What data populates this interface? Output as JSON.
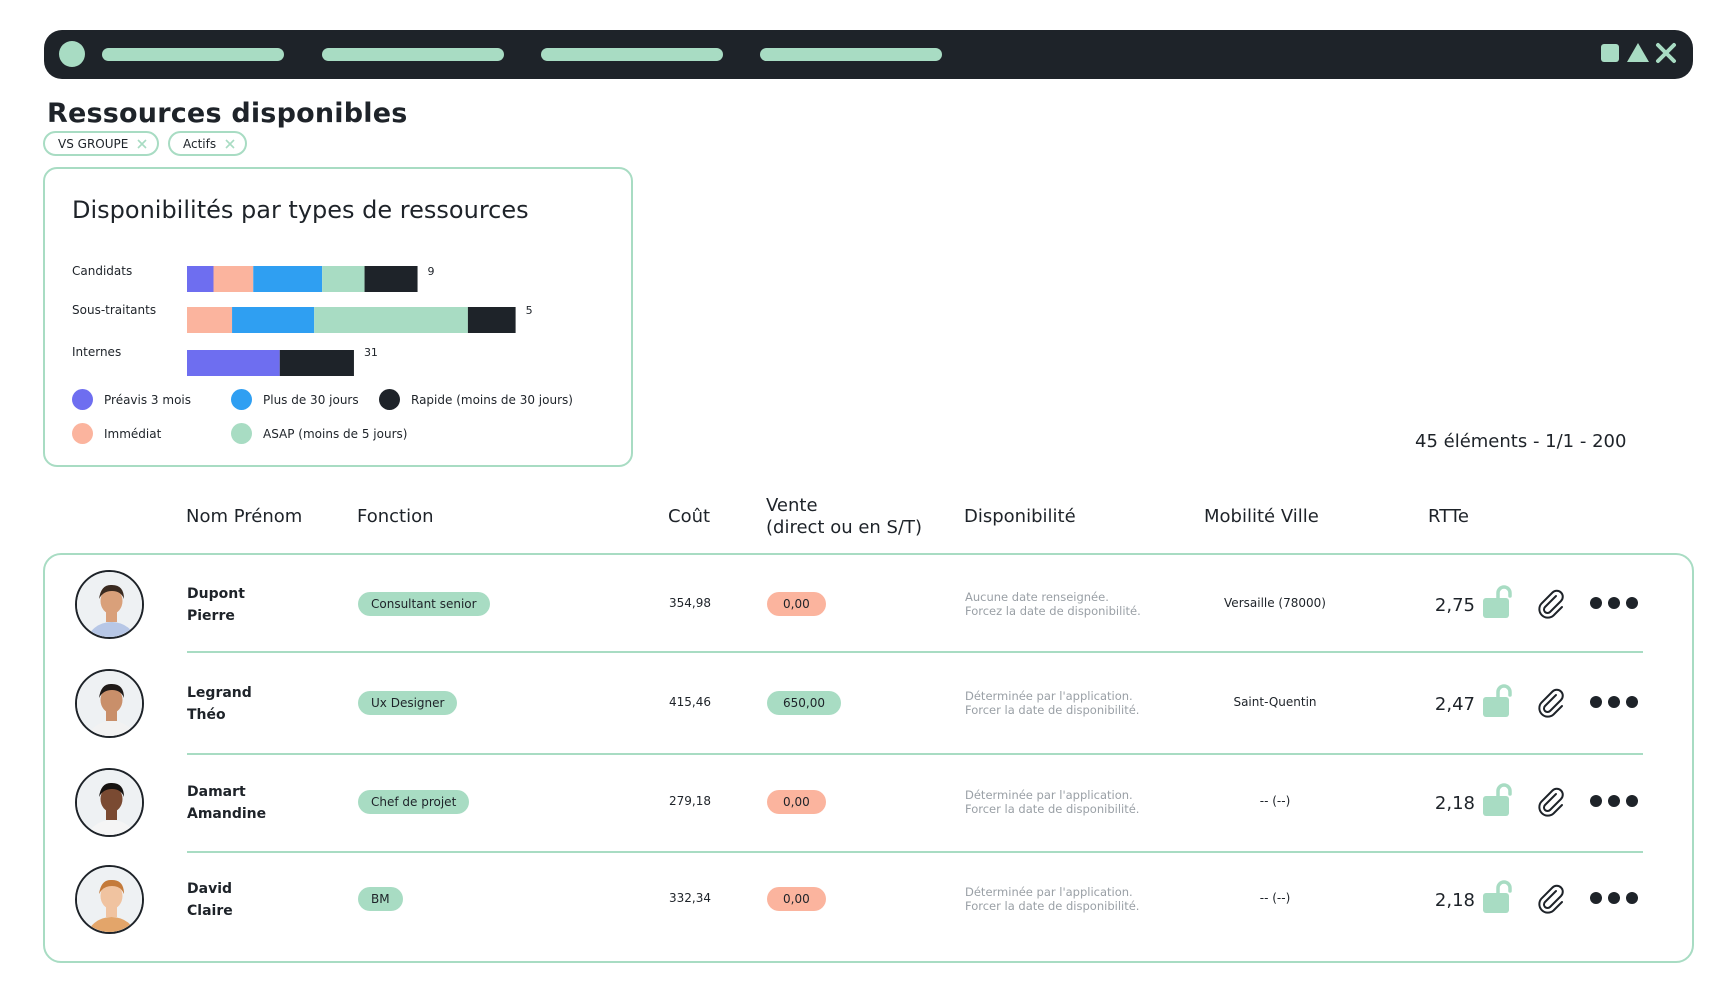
{
  "page": {
    "title": "Ressources disponibles",
    "filters": [
      {
        "label": "VS GROUPE"
      },
      {
        "label": "Actifs"
      }
    ],
    "counter": "45 éléments - 1/1 - 200"
  },
  "colors": {
    "dark": "#1e2329",
    "mint": "#a8dcc3",
    "purple": "#6e6ef0",
    "peach": "#fbb49e",
    "blue": "#2f9ff2",
    "sale_zero": "#fbb49e",
    "sale_positive": "#a8dcc3"
  },
  "chart_data": {
    "type": "bar",
    "orientation": "horizontal",
    "stacked": true,
    "title": "Disponibilités par types de ressources",
    "categories": [
      "Candidats",
      "Sous-traitants",
      "Internes"
    ],
    "totals": [
      "9",
      "5",
      "31"
    ],
    "series": [
      {
        "name": "Préavis 3 mois",
        "color": "#6e6ef0",
        "values": [
          10,
          0,
          35
        ]
      },
      {
        "name": "Immédiat",
        "color": "#fbb49e",
        "values": [
          15,
          17,
          0
        ]
      },
      {
        "name": "Plus de 30 jours",
        "color": "#2f9ff2",
        "values": [
          26,
          31,
          0
        ]
      },
      {
        "name": "ASAP (moins de 5 jours)",
        "color": "#a8dcc3",
        "values": [
          16,
          58,
          0
        ]
      },
      {
        "name": "Rapide (moins de 30 jours)",
        "color": "#1e2329",
        "values": [
          20,
          18,
          28
        ]
      }
    ],
    "legend": [
      {
        "name": "Préavis 3 mois",
        "color": "#6e6ef0"
      },
      {
        "name": "Plus de 30 jours",
        "color": "#2f9ff2"
      },
      {
        "name": "Rapide (moins de 30 jours)",
        "color": "#1e2329"
      },
      {
        "name": "Immédiat",
        "color": "#fbb49e"
      },
      {
        "name": "ASAP (moins de 5 jours)",
        "color": "#a8dcc3"
      }
    ],
    "legend_position": "bottom",
    "grid": false
  },
  "table": {
    "headers": {
      "name": "Nom Prénom",
      "function": "Fonction",
      "cost": "Coût",
      "sale_line1": "Vente",
      "sale_line2": "(direct ou en S/T)",
      "availability": "Disponibilité",
      "mobility": "Mobilité Ville",
      "rtte": "RTTe"
    },
    "rows": [
      {
        "last_name": "Dupont",
        "first_name": "Pierre",
        "function": "Consultant senior",
        "cost": "354,98",
        "sale": "0,00",
        "sale_status": "zero",
        "availability_line1": "Aucune date renseignée.",
        "availability_line2": "Forcez la date de disponibilité.",
        "city": "Versaille (78000)",
        "rtte": "2,75",
        "avatar": {
          "skin": "#d9a07a",
          "hair": "#3a2a20",
          "shirt": "#b7c7e6"
        }
      },
      {
        "last_name": "Legrand",
        "first_name": "Théo",
        "function": "Ux Designer",
        "cost": "415,46",
        "sale": "650,00",
        "sale_status": "positive",
        "availability_line1": "Déterminée par l'application.",
        "availability_line2": "Forcer la date de disponibilité.",
        "city": "Saint-Quentin",
        "rtte": "2,47",
        "avatar": {
          "skin": "#c98f6a",
          "hair": "#1f1a18",
          "shirt": "#f2f2f2"
        }
      },
      {
        "last_name": "Damart",
        "first_name": "Amandine",
        "function": "Chef de projet",
        "cost": "279,18",
        "sale": "0,00",
        "sale_status": "zero",
        "availability_line1": "Déterminée par l'application.",
        "availability_line2": "Forcer la date de disponibilité.",
        "city": "-- (--)",
        "rtte": "2,18",
        "avatar": {
          "skin": "#7a4a32",
          "hair": "#151210",
          "shirt": "#f5f5f5"
        }
      },
      {
        "last_name": "David",
        "first_name": "Claire",
        "function": "BM",
        "cost": "332,34",
        "sale": "0,00",
        "sale_status": "zero",
        "availability_line1": "Déterminée par l'application.",
        "availability_line2": "Forcer la date de disponibilité.",
        "city": "-- (--)",
        "rtte": "2,18",
        "avatar": {
          "skin": "#f0c3a0",
          "hair": "#c47a3a",
          "shirt": "#e3a56a"
        }
      }
    ]
  }
}
